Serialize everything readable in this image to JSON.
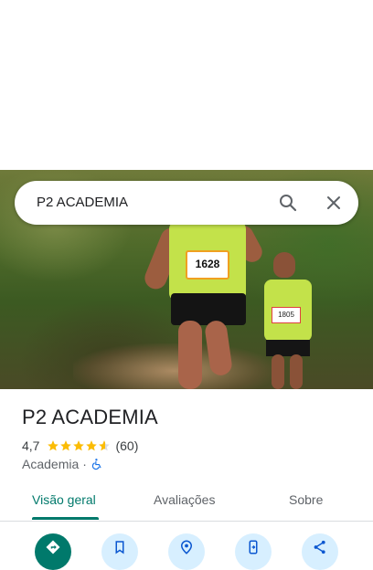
{
  "search": {
    "query": "P2 ACADEMIA"
  },
  "photo": {
    "bib_main": "1628",
    "bib_small": "1805"
  },
  "place": {
    "name": "P2 ACADEMIA",
    "rating": "4,7",
    "stars": 4.7,
    "review_count": "(60)",
    "category": "Academia",
    "separator": "·"
  },
  "tabs": [
    {
      "label": "Visão geral",
      "active": true
    },
    {
      "label": "Avaliações"
    },
    {
      "label": "Sobre"
    }
  ],
  "actions": [
    {
      "icon": "directions-icon"
    },
    {
      "icon": "bookmark-icon"
    },
    {
      "icon": "nearby-icon"
    },
    {
      "icon": "send-to-phone-icon"
    },
    {
      "icon": "share-icon"
    }
  ],
  "colors": {
    "accent": "#00796b",
    "star": "#fbbc04",
    "action_bg": "#d7efff"
  }
}
